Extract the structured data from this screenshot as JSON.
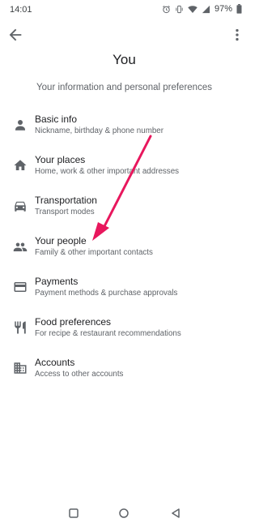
{
  "status_bar": {
    "time": "14:01",
    "battery": "97%"
  },
  "header": {
    "title": "You",
    "subtitle": "Your information and personal preferences"
  },
  "items": [
    {
      "title": "Basic info",
      "subtitle": "Nickname, birthday & phone number",
      "icon": "person-icon"
    },
    {
      "title": "Your places",
      "subtitle": "Home, work & other important addresses",
      "icon": "home-icon"
    },
    {
      "title": "Transportation",
      "subtitle": "Transport modes",
      "icon": "car-icon"
    },
    {
      "title": "Your people",
      "subtitle": "Family & other important contacts",
      "icon": "people-icon"
    },
    {
      "title": "Payments",
      "subtitle": "Payment methods & purchase approvals",
      "icon": "credit-card-icon"
    },
    {
      "title": "Food preferences",
      "subtitle": "For recipe & restaurant recommendations",
      "icon": "restaurant-icon"
    },
    {
      "title": "Accounts",
      "subtitle": "Access to other accounts",
      "icon": "building-icon"
    }
  ],
  "colors": {
    "icon": "#5f6368",
    "annotation_arrow": "#e8175d"
  }
}
